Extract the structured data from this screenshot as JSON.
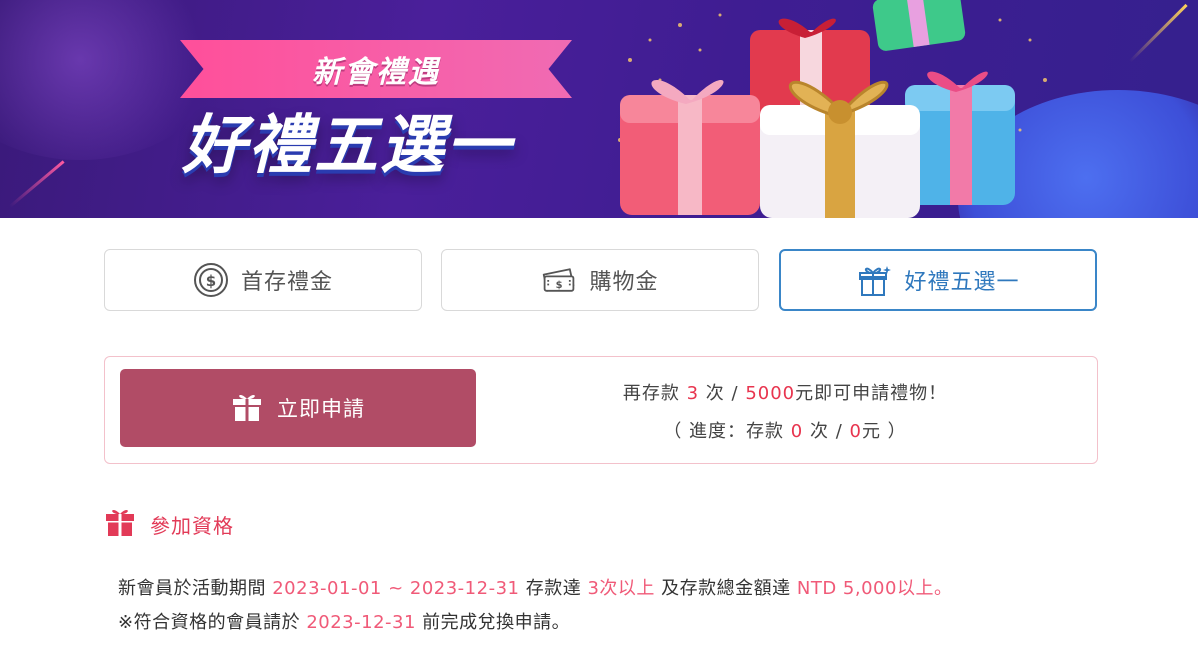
{
  "banner": {
    "ribbon_text": "新會禮遇",
    "headline": "好禮五選一"
  },
  "tabs": [
    {
      "label": "首存禮金",
      "icon": "coin-icon",
      "active": false
    },
    {
      "label": "購物金",
      "icon": "voucher-icon",
      "active": false
    },
    {
      "label": "好禮五選一",
      "icon": "gift-icon",
      "active": true
    }
  ],
  "apply": {
    "button_label": "立即申請",
    "line1": {
      "prefix": "再存款",
      "count": "3",
      "mid": "次 /",
      "amount": "5000",
      "suffix": "元即可申請禮物！"
    },
    "line2": {
      "prefix": "（ 進度：存款",
      "count": "0",
      "mid": "次 /",
      "amount": "0",
      "suffix": "元 ）"
    }
  },
  "eligibility": {
    "title": "參加資格",
    "rule1": {
      "t1": "新會員於活動期間",
      "period": "2023-01-01 ~ 2023-12-31",
      "t2": "存款達",
      "times": "3次以上",
      "t3": "及存款總金額達",
      "amount": "NTD 5,000以上。"
    },
    "rule2": {
      "t1": "※符合資格的會員請於",
      "deadline": "2023-12-31",
      "t2": "前完成兌換申請。"
    }
  },
  "colors": {
    "accent_red": "#e8344e",
    "button": "#b14c66",
    "active_tab": "#3a86c8"
  }
}
